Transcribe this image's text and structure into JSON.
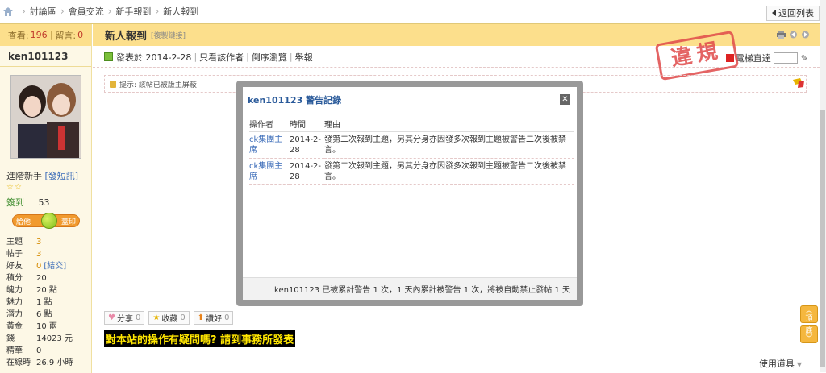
{
  "breadcrumb": {
    "items": [
      "討論區",
      "會員交流",
      "新手報到",
      "新人報到"
    ]
  },
  "back_button": "返回列表",
  "sidebar": {
    "stats": {
      "views_label": "查看:",
      "views": "196",
      "sep": "|",
      "replies_label": "留言:",
      "replies": "0"
    },
    "username": "ken101123",
    "rank": "進階新手",
    "pm_link": "[發短訊]",
    "stars": "☆☆",
    "checkin_label": "簽到",
    "checkin_value": "53",
    "gift_left": "給他",
    "gift_right": "蓋印",
    "info": [
      {
        "k": "主題",
        "v": "3"
      },
      {
        "k": "帖子",
        "v": "3"
      },
      {
        "k": "好友",
        "v": "0",
        "link": "[結交]"
      },
      {
        "k": "積分",
        "v": "20"
      },
      {
        "k": "魄力",
        "v": "20 點"
      },
      {
        "k": "魅力",
        "v": "1 點"
      },
      {
        "k": "潛力",
        "v": "6 點"
      },
      {
        "k": "黃金",
        "v": "10 兩"
      },
      {
        "k": "錢",
        "v": "14023 元"
      },
      {
        "k": "精華",
        "v": "0"
      },
      {
        "k": "在線時",
        "v": "26.9 小時"
      }
    ]
  },
  "post": {
    "title": "新人報到",
    "copy_link": "[複製鏈接]",
    "posted_on": "發表於 2014-2-28",
    "only_author": "只看該作者",
    "reverse": "倒序瀏覽",
    "report": "舉報",
    "jump_label": "電梯直達",
    "stamp": "違規",
    "notice": "提示: 該帖已被版主屏蔽",
    "share": {
      "label": "分享",
      "count": "0"
    },
    "fav": {
      "label": "收藏",
      "count": "0"
    },
    "like": {
      "label": "讚好",
      "count": "0"
    },
    "banner": "對本站的操作有疑問嗎? 請到事務所發表",
    "tools": "使用道具"
  },
  "updown": {
    "up": "頂",
    "down": "底"
  },
  "modal": {
    "title": "ken101123 警告記錄",
    "headers": [
      "操作者",
      "時間",
      "理由"
    ],
    "rows": [
      {
        "op": "ck集團主席",
        "time": "2014-2-28",
        "reason": "發第二次報到主題，另其分身亦因發多次報到主題被警告二次後被禁言。"
      },
      {
        "op": "ck集團主席",
        "time": "2014-2-28",
        "reason": "發第二次報到主題，另其分身亦因發多次報到主題被警告二次後被禁言。"
      }
    ],
    "footer": "ken101123 已被累計警告 1 次，1 天內累計被警告 1 次，將被自動禁止發帖 1 天"
  },
  "colors": {
    "accent": "#fcdf8c",
    "link": "#3a6bb8",
    "stamp": "#e04a4a"
  }
}
